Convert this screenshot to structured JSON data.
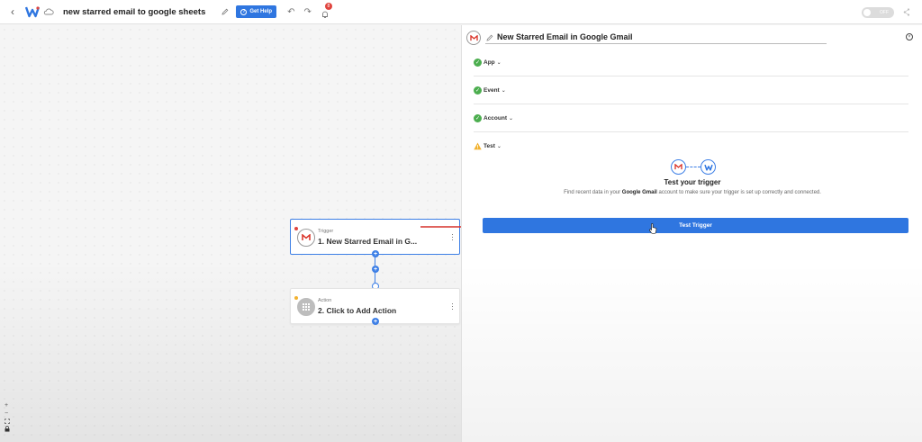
{
  "topbar": {
    "back_icon": "chevron-left-icon",
    "logo_icon": "w-logo-icon",
    "workflow_title": "new starred email to google sheets",
    "help_label": "Get Help",
    "help_icon_glyph": "?",
    "notification_count": "8",
    "toggle_label": "OFF"
  },
  "canvas": {
    "trigger_node": {
      "type_label": "Trigger",
      "title": "1. New Starred Email in G...",
      "app_icon": "gmail-icon"
    },
    "action_node": {
      "type_label": "Action",
      "title": "2. Click to Add Action",
      "app_icon": "grid-icon"
    },
    "add_step_glyph": "+",
    "zoom_in": "+",
    "zoom_out": "−"
  },
  "panel": {
    "title": "New Starred Email in Google Gmail",
    "close_glyph": "×",
    "sections": [
      {
        "label": "App",
        "status": "complete"
      },
      {
        "label": "Event",
        "status": "complete"
      },
      {
        "label": "Account",
        "status": "complete"
      },
      {
        "label": "Test",
        "status": "warning"
      }
    ],
    "test": {
      "heading": "Test your trigger",
      "desc_before": "Find recent data in your ",
      "desc_app": "Google Gmail",
      "desc_after": " account to make sure your trigger is set up correctly and connected.",
      "button_label": "Test Trigger"
    }
  },
  "colors": {
    "accent": "#2f76e0",
    "success": "#4cae4f",
    "warning": "#f2b230",
    "error": "#e0443e"
  }
}
